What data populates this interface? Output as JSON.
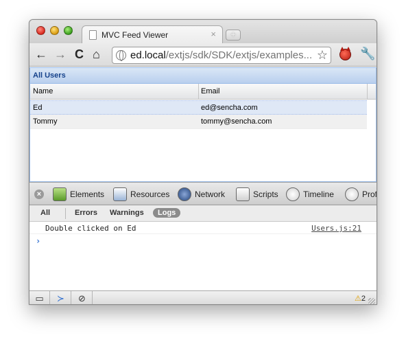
{
  "browser": {
    "tab_title": "MVC Feed Viewer",
    "tab_close": "×",
    "new_tab": "+",
    "url_host": "ed.local",
    "url_path": "/extjs/sdk/SDK/extjs/examples...",
    "nav": {
      "back": "←",
      "forward": "→",
      "reload": "C",
      "home": "⌂",
      "star": "☆",
      "wrench": "🔧"
    }
  },
  "grid": {
    "title": "All Users",
    "columns": [
      "Name",
      "Email"
    ],
    "rows": [
      {
        "name": "Ed",
        "email": "ed@sencha.com"
      },
      {
        "name": "Tommy",
        "email": "tommy@sencha.com"
      }
    ]
  },
  "devtools": {
    "tabs": [
      "Elements",
      "Resources",
      "Network",
      "Scripts",
      "Timeline",
      "Profi"
    ],
    "filters": [
      "All",
      "Errors",
      "Warnings",
      "Logs"
    ],
    "active_filter": "Logs",
    "log": {
      "message": "Double clicked on Ed",
      "source": "Users.js:21"
    },
    "prompt": "›",
    "status": {
      "warning_count": "2",
      "warning_icon": "⚠"
    }
  }
}
